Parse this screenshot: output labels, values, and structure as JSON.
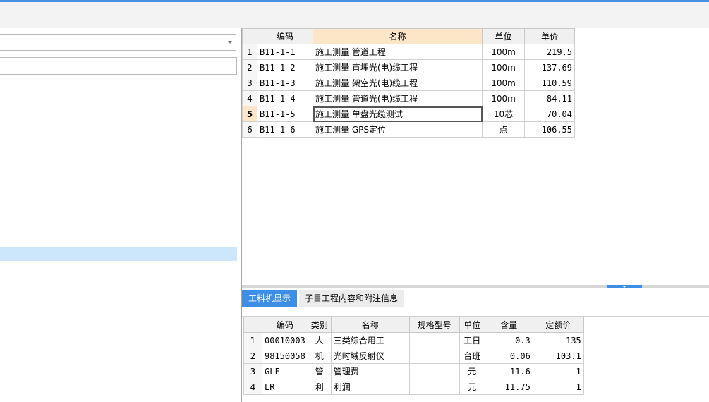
{
  "main_table": {
    "headers": [
      "",
      "编码",
      "名称",
      "单位",
      "单价"
    ],
    "rows": [
      {
        "n": "1",
        "code": "B11-1-1",
        "name": "施工测量 管道工程",
        "unit": "100m",
        "price": "219.5"
      },
      {
        "n": "2",
        "code": "B11-1-2",
        "name": "施工测量 直埋光(电)缆工程",
        "unit": "100m",
        "price": "137.69"
      },
      {
        "n": "3",
        "code": "B11-1-3",
        "name": "施工测量 架空光(电)缆工程",
        "unit": "100m",
        "price": "110.59"
      },
      {
        "n": "4",
        "code": "B11-1-4",
        "name": "施工测量 管道光(电)缆工程",
        "unit": "100m",
        "price": "84.11"
      },
      {
        "n": "5",
        "code": "B11-1-5",
        "name": "施工测量 单盘光缆测试",
        "unit": "10芯",
        "price": "70.04"
      },
      {
        "n": "6",
        "code": "B11-1-6",
        "name": "施工测量 GPS定位",
        "unit": "点",
        "price": "106.55"
      }
    ],
    "selected_row": 4
  },
  "tabs": [
    {
      "label": "工料机显示",
      "active": true
    },
    {
      "label": "子目工程内容和附注信息",
      "active": false
    }
  ],
  "resource_table": {
    "headers": [
      "",
      "编码",
      "类别",
      "名称",
      "规格型号",
      "单位",
      "含量",
      "定额价"
    ],
    "rows": [
      {
        "n": "1",
        "code": "00010003",
        "type": "人",
        "name": "三类综合用工",
        "spec": "",
        "unit": "工日",
        "qty": "0.3",
        "price": "135"
      },
      {
        "n": "2",
        "code": "98150058",
        "type": "机",
        "name": "光时域反射仪",
        "spec": "",
        "unit": "台班",
        "qty": "0.06",
        "price": "103.1"
      },
      {
        "n": "3",
        "code": "GLF",
        "type": "管",
        "name": "管理费",
        "spec": "",
        "unit": "元",
        "qty": "11.6",
        "price": "1"
      },
      {
        "n": "4",
        "code": "LR",
        "type": "利",
        "name": "利润",
        "spec": "",
        "unit": "元",
        "qty": "11.75",
        "price": "1"
      }
    ]
  },
  "colors": {
    "accent": "#3d8fe6",
    "header_highlight": "#fde6c8",
    "tree_selection": "#cce6fb"
  },
  "icons": {
    "dropdown": "chevron-down-icon",
    "splitter": "chevron-down-icon"
  }
}
